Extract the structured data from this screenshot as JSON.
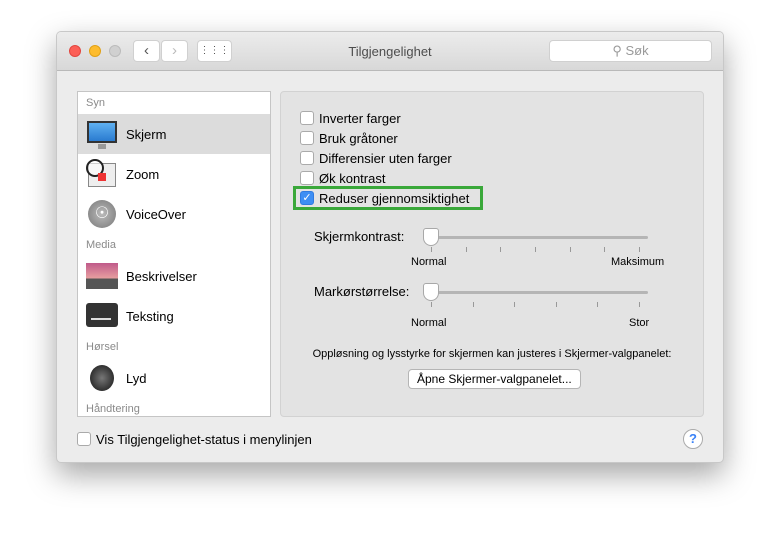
{
  "window": {
    "title": "Tilgjengelighet",
    "search_placeholder": "Søk",
    "back": "‹",
    "forward": "›",
    "grid": "⋮⋮⋮"
  },
  "sidebar": {
    "sections": [
      {
        "label": "Syn",
        "items": [
          {
            "label": "Skjerm",
            "icon": "display-icon",
            "selected": true
          },
          {
            "label": "Zoom",
            "icon": "zoom-icon"
          },
          {
            "label": "VoiceOver",
            "icon": "voiceover-icon"
          }
        ]
      },
      {
        "label": "Media",
        "items": [
          {
            "label": "Beskrivelser",
            "icon": "descriptions-icon"
          },
          {
            "label": "Teksting",
            "icon": "captions-icon"
          }
        ]
      },
      {
        "label": "Hørsel",
        "items": [
          {
            "label": "Lyd",
            "icon": "speaker-icon"
          }
        ]
      },
      {
        "label": "Håndtering",
        "items": []
      }
    ]
  },
  "options": [
    {
      "label": "Inverter farger",
      "checked": false
    },
    {
      "label": "Bruk gråtoner",
      "checked": false
    },
    {
      "label": "Differensier uten farger",
      "checked": false
    },
    {
      "label": "Øk kontrast",
      "checked": false
    },
    {
      "label": "Reduser gjennomsiktighet",
      "checked": true
    }
  ],
  "contrast": {
    "label": "Skjermkontrast:",
    "min": "Normal",
    "max": "Maksimum",
    "value": 0
  },
  "cursor": {
    "label": "Markørstørrelse:",
    "min": "Normal",
    "max": "Stor",
    "value": 0
  },
  "note": "Oppløsning og lysstyrke for skjermen kan justeres i Skjermer-valgpanelet:",
  "open_button": "Åpne Skjermer-valgpanelet...",
  "status_checkbox": {
    "label": "Vis Tilgjengelighet-status i menylinjen",
    "checked": false
  },
  "help": "?",
  "check": "✓"
}
